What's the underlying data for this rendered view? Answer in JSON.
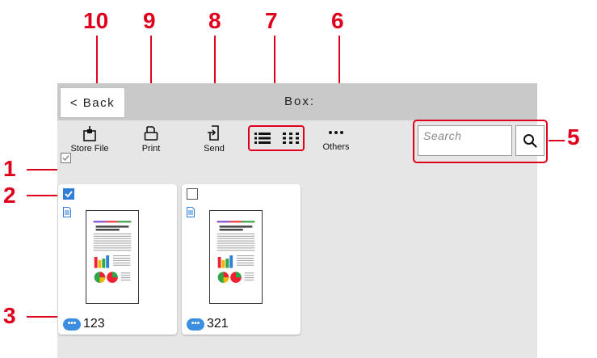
{
  "callouts": [
    "10",
    "9",
    "8",
    "7",
    "6",
    "5",
    "1",
    "2",
    "3"
  ],
  "topbar": {
    "back_label": "< Back",
    "box_label": "Box:"
  },
  "toolbar": {
    "store_file_label": "Store File",
    "print_label": "Print",
    "send_label": "Send",
    "others_label": "Others"
  },
  "search": {
    "placeholder": "Search"
  },
  "files": [
    {
      "name": "123",
      "selected": true
    },
    {
      "name": "321",
      "selected": false
    }
  ],
  "colors": {
    "callout": "#e0001b",
    "check_on": "#2f7fd8",
    "bubble": "#3b8ee0"
  }
}
